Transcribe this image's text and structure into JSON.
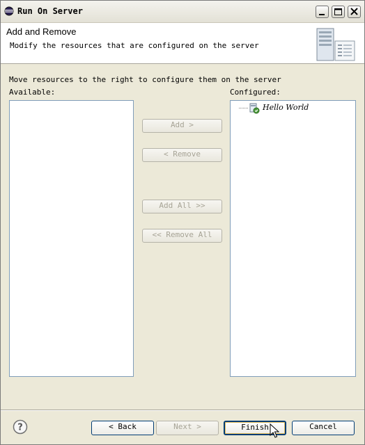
{
  "window": {
    "title": "Run On Server"
  },
  "header": {
    "title": "Add and Remove",
    "description": "Modify the resources that are configured on the server"
  },
  "main": {
    "instruction": "Move resources to the right to configure them on the server",
    "available_label": "Available:",
    "configured_label": "Configured:",
    "configured_items": [
      {
        "label": "Hello World",
        "icon": "project-server-icon"
      }
    ]
  },
  "buttons": {
    "add": "Add >",
    "remove": "< Remove",
    "add_all": "Add All >>",
    "remove_all": "<< Remove All"
  },
  "footer": {
    "back": "< Back",
    "next": "Next >",
    "finish": "Finish",
    "cancel": "Cancel"
  }
}
